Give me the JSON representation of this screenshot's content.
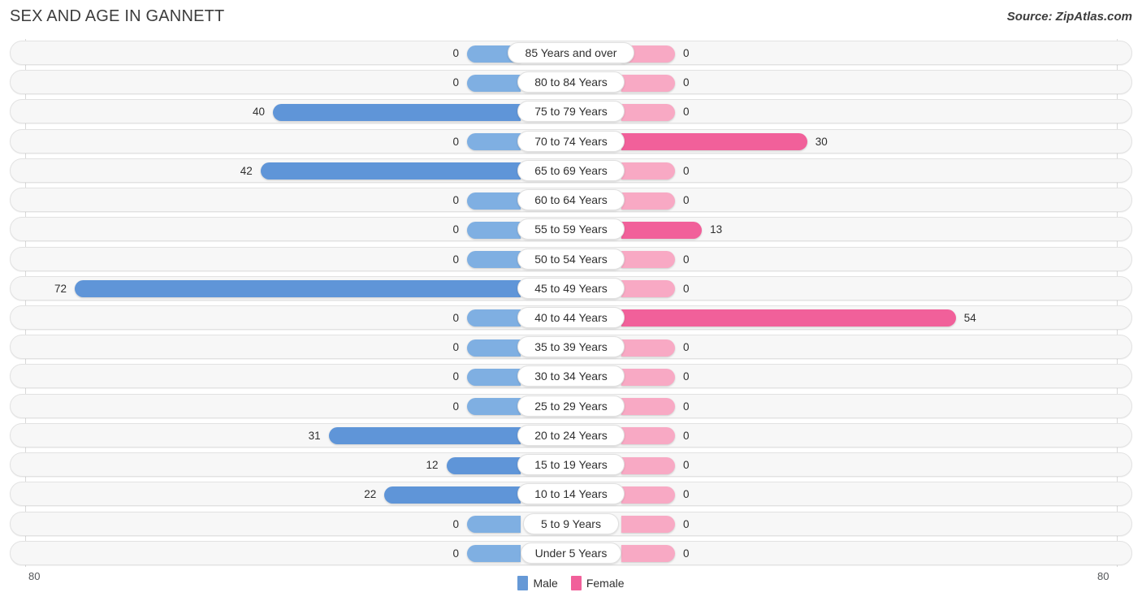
{
  "header": {
    "title": "SEX AND AGE IN GANNETT",
    "source": "Source: ZipAtlas.com"
  },
  "axis": {
    "left_label": "80",
    "right_label": "80",
    "max": 80
  },
  "legend": {
    "male": {
      "label": "Male",
      "color": "#6699d6"
    },
    "female": {
      "label": "Female",
      "color": "#f1609a"
    }
  },
  "colors": {
    "male_light": "#7fafe2",
    "male_strong": "#5f95d8",
    "female_light": "#f8a9c4",
    "female_strong": "#f1609a",
    "track": "#f7f7f7",
    "track_border": "#e2e2e2",
    "gridline": "#d9d9d9"
  },
  "chart_data": {
    "type": "bar",
    "title": "Sex and Age in Gannett",
    "subtitle": "Source: ZipAtlas.com",
    "orientation": "horizontal-diverging",
    "xlabel": "",
    "ylabel": "",
    "xlim": [
      -80,
      80
    ],
    "grid": false,
    "legend_position": "bottom-center",
    "categories": [
      "85 Years and over",
      "80 to 84 Years",
      "75 to 79 Years",
      "70 to 74 Years",
      "65 to 69 Years",
      "60 to 64 Years",
      "55 to 59 Years",
      "50 to 54 Years",
      "45 to 49 Years",
      "40 to 44 Years",
      "35 to 39 Years",
      "30 to 34 Years",
      "25 to 29 Years",
      "20 to 24 Years",
      "15 to 19 Years",
      "10 to 14 Years",
      "5 to 9 Years",
      "Under 5 Years"
    ],
    "series": [
      {
        "name": "Male",
        "values": [
          0,
          0,
          40,
          0,
          42,
          0,
          0,
          0,
          72,
          0,
          0,
          0,
          0,
          31,
          12,
          22,
          0,
          0
        ]
      },
      {
        "name": "Female",
        "values": [
          0,
          0,
          0,
          30,
          0,
          0,
          13,
          0,
          0,
          54,
          0,
          0,
          0,
          0,
          0,
          0,
          0,
          0
        ]
      }
    ]
  },
  "rows": [
    {
      "label": "85 Years and over",
      "male": 0,
      "female": 0
    },
    {
      "label": "80 to 84 Years",
      "male": 0,
      "female": 0
    },
    {
      "label": "75 to 79 Years",
      "male": 40,
      "female": 0
    },
    {
      "label": "70 to 74 Years",
      "male": 0,
      "female": 30
    },
    {
      "label": "65 to 69 Years",
      "male": 42,
      "female": 0
    },
    {
      "label": "60 to 64 Years",
      "male": 0,
      "female": 0
    },
    {
      "label": "55 to 59 Years",
      "male": 0,
      "female": 13
    },
    {
      "label": "50 to 54 Years",
      "male": 0,
      "female": 0
    },
    {
      "label": "45 to 49 Years",
      "male": 72,
      "female": 0
    },
    {
      "label": "40 to 44 Years",
      "male": 0,
      "female": 54
    },
    {
      "label": "35 to 39 Years",
      "male": 0,
      "female": 0
    },
    {
      "label": "30 to 34 Years",
      "male": 0,
      "female": 0
    },
    {
      "label": "25 to 29 Years",
      "male": 0,
      "female": 0
    },
    {
      "label": "20 to 24 Years",
      "male": 31,
      "female": 0
    },
    {
      "label": "15 to 19 Years",
      "male": 12,
      "female": 0
    },
    {
      "label": "10 to 14 Years",
      "male": 22,
      "female": 0
    },
    {
      "label": "5 to 9 Years",
      "male": 0,
      "female": 0
    },
    {
      "label": "Under 5 Years",
      "male": 0,
      "female": 0
    }
  ]
}
